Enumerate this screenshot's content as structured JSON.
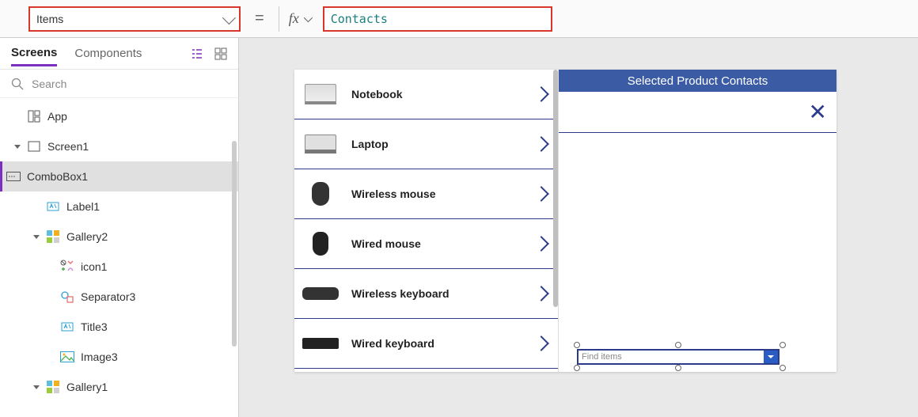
{
  "formula_bar": {
    "property": "Items",
    "fx_label": "fx",
    "formula": "Contacts"
  },
  "left_panel": {
    "tab_screens": "Screens",
    "tab_components": "Components",
    "search_placeholder": "Search",
    "tree": {
      "app": "App",
      "screen1": "Screen1",
      "combobox1": "ComboBox1",
      "label1": "Label1",
      "gallery2": "Gallery2",
      "icon1": "icon1",
      "separator3": "Separator3",
      "title3": "Title3",
      "image3": "Image3",
      "gallery1": "Gallery1"
    }
  },
  "canvas": {
    "header_title": "Selected Product Contacts",
    "combobox_placeholder": "Find items",
    "gallery_items": [
      {
        "label": "Notebook",
        "thumb": "thumb-notebook"
      },
      {
        "label": "Laptop",
        "thumb": "thumb-laptop"
      },
      {
        "label": "Wireless mouse",
        "thumb": "thumb-mouse"
      },
      {
        "label": "Wired mouse",
        "thumb": "thumb-mouse2"
      },
      {
        "label": "Wireless keyboard",
        "thumb": "thumb-kb"
      },
      {
        "label": "Wired keyboard",
        "thumb": "thumb-kb2"
      }
    ]
  }
}
